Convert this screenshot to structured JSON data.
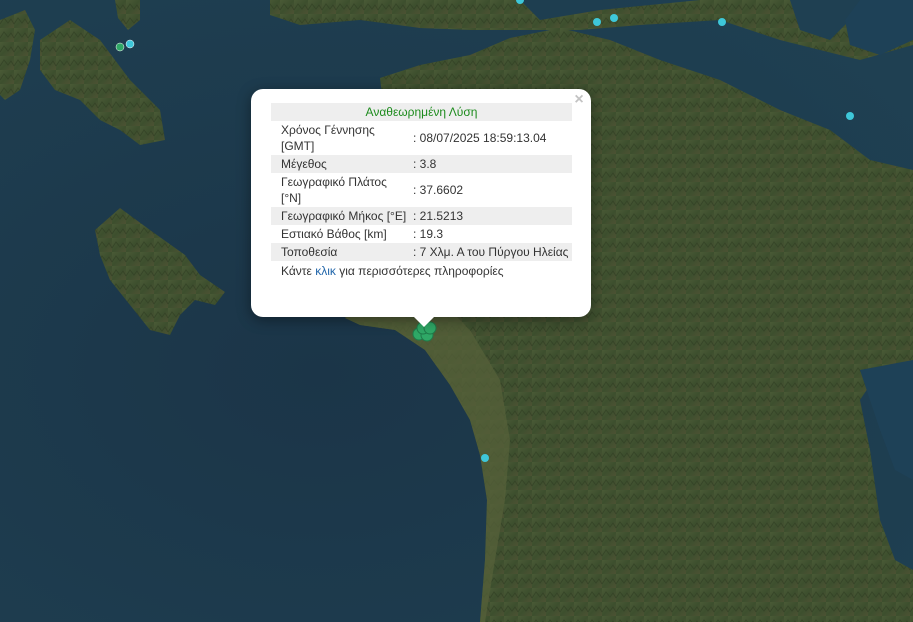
{
  "popup": {
    "title": "Αναθεωρημένη Λύση",
    "close_label": "×",
    "rows": [
      {
        "label": "Χρόνος Γέννησης [GMT]",
        "value": ": 08/07/2025 18:59:13.04"
      },
      {
        "label": "Μέγεθος",
        "value": ": 3.8"
      },
      {
        "label": "Γεωγραφικό Πλάτος [°N]",
        "value": ": 37.6602"
      },
      {
        "label": "Γεωγραφικό Μήκος [°E]",
        "value": ": 21.5213"
      },
      {
        "label": "Εστιακό Βάθος [km]",
        "value": ": 19.3"
      },
      {
        "label": "Τοποθεσία",
        "value": ": 7 Χλμ. Α του Πύργου Ηλείας"
      }
    ],
    "footer": {
      "before": "Κάντε ",
      "link": "κλικ",
      "after": " για περισσότερες πληροφορίες"
    }
  },
  "colors": {
    "sea": "#1c3a4c",
    "land": "#3f5330",
    "marker_recent": "#2fa866",
    "marker_older": "#3ec7d9",
    "title_green": "#1d8b1d"
  }
}
